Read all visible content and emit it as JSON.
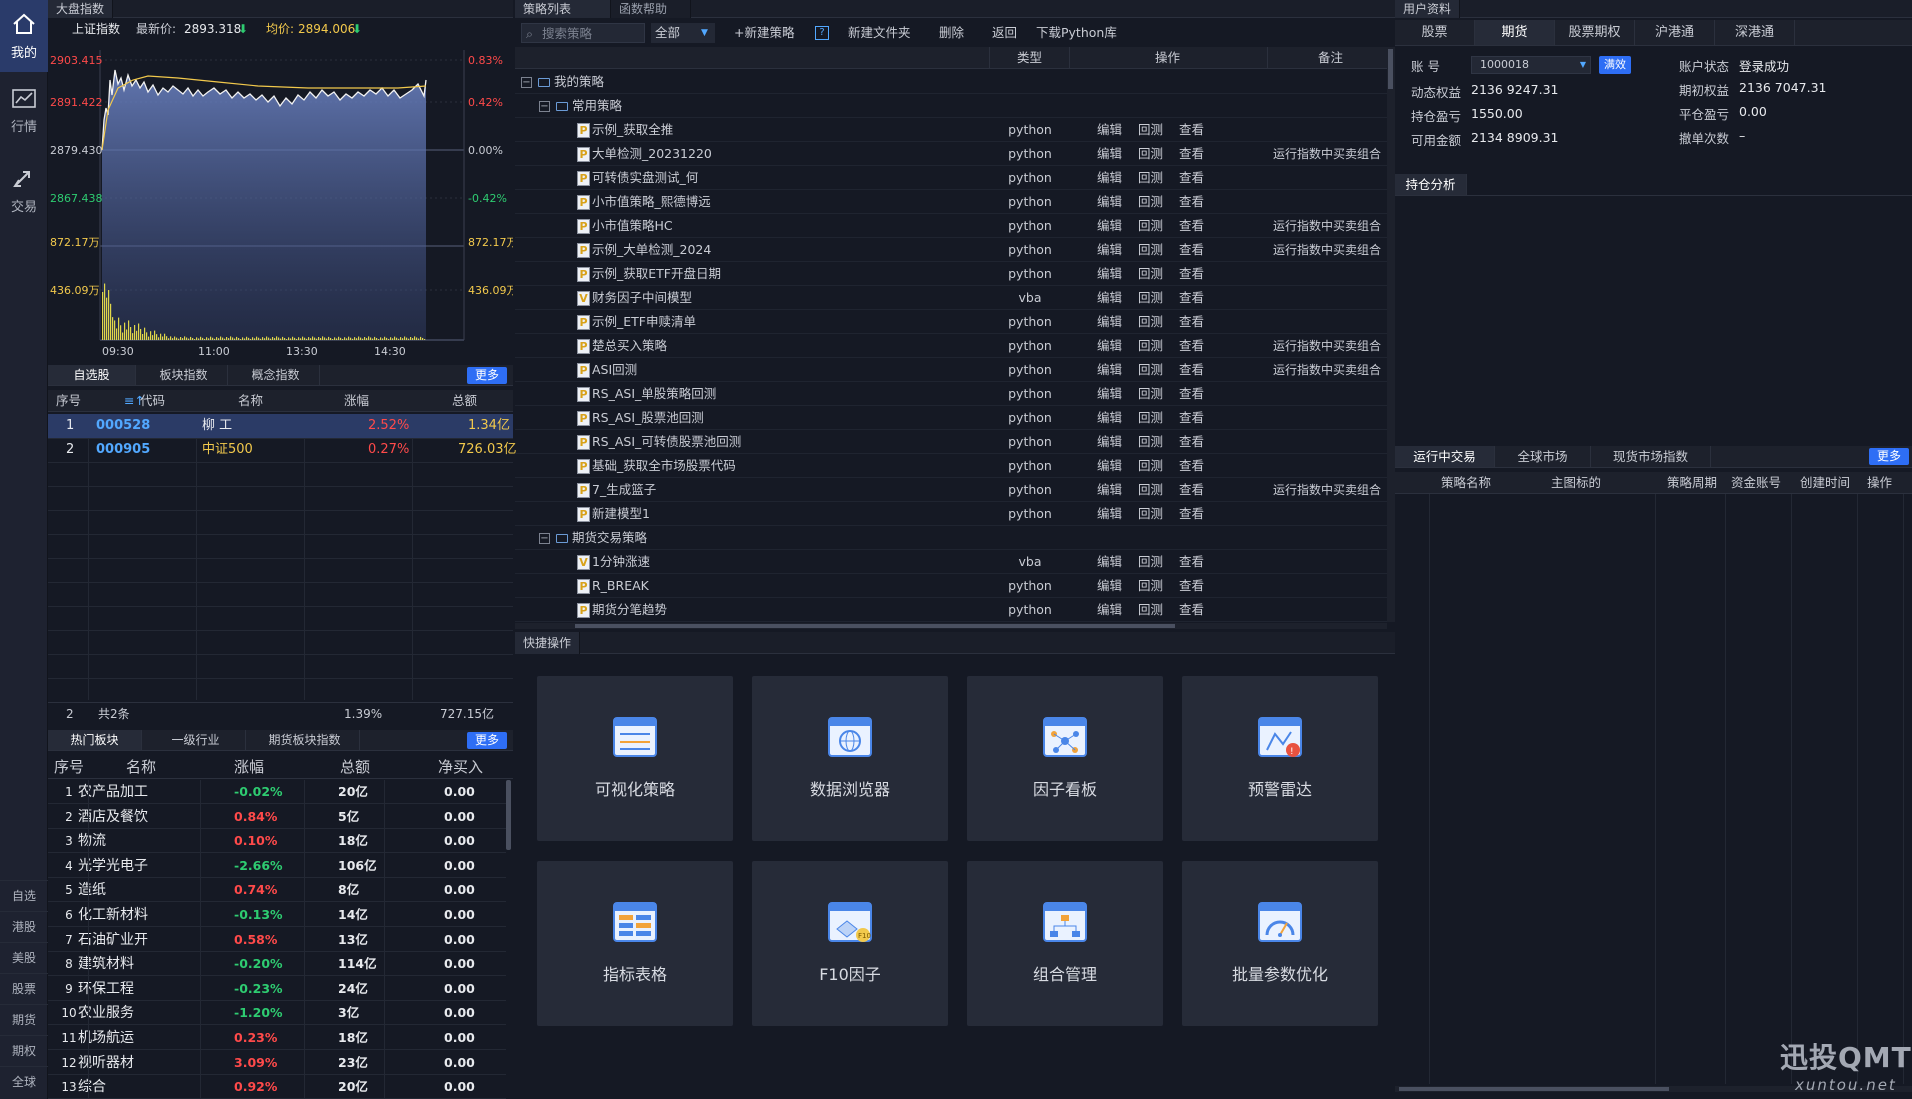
{
  "rail": {
    "main": [
      {
        "label": "我的",
        "icon": "home-icon"
      },
      {
        "label": "行情",
        "icon": "chart-icon"
      },
      {
        "label": "交易",
        "icon": "trade-icon"
      }
    ],
    "small": [
      "自选",
      "港股",
      "美股",
      "股票",
      "期货",
      "期权",
      "全球"
    ]
  },
  "market": {
    "header": "大盘指数",
    "index_name": "上证指数",
    "latest_label": "最新价:",
    "latest_value": "2893.318",
    "avg_label": "均价:",
    "avg_value": "2894.006",
    "left_axis": [
      "2903.415",
      "2891.422",
      "2879.430",
      "2867.438",
      "872.17万",
      "436.09万"
    ],
    "right_axis": [
      "0.83%",
      "0.42%",
      "0.00%",
      "-0.42%",
      "872.17万",
      "436.09万"
    ],
    "time_ticks": [
      "09:30",
      "11:00",
      "13:30",
      "14:30"
    ]
  },
  "watch": {
    "tabs": [
      "自选股",
      "板块指数",
      "概念指数"
    ],
    "more": "更多",
    "columns": [
      "序号",
      "代码",
      "名称",
      "涨幅",
      "总额"
    ],
    "rows": [
      {
        "no": "1",
        "code": "000528",
        "name": "柳 工",
        "chg": "2.52%",
        "amt": "1.34亿"
      },
      {
        "no": "2",
        "code": "000905",
        "name": "中证500",
        "chg": "0.27%",
        "amt": "726.03亿"
      }
    ],
    "footer": {
      "no": "2",
      "count": "共2条",
      "chg": "1.39%",
      "amt": "727.15亿"
    }
  },
  "sectors": {
    "tabs": [
      "热门板块",
      "一级行业",
      "期货板块指数"
    ],
    "more": "更多",
    "columns": [
      "序号",
      "名称",
      "涨幅",
      "总额",
      "净买入"
    ],
    "rows": [
      {
        "no": "1",
        "name": "农产品加工",
        "chg": "-0.02%",
        "amt": "20亿",
        "net": "0.00"
      },
      {
        "no": "2",
        "name": "酒店及餐饮",
        "chg": "0.84%",
        "amt": "5亿",
        "net": "0.00"
      },
      {
        "no": "3",
        "name": "物流",
        "chg": "0.10%",
        "amt": "18亿",
        "net": "0.00"
      },
      {
        "no": "4",
        "name": "光学光电子",
        "chg": "-2.66%",
        "amt": "106亿",
        "net": "0.00"
      },
      {
        "no": "5",
        "name": "造纸",
        "chg": "0.74%",
        "amt": "8亿",
        "net": "0.00"
      },
      {
        "no": "6",
        "name": "化工新材料",
        "chg": "-0.13%",
        "amt": "14亿",
        "net": "0.00"
      },
      {
        "no": "7",
        "name": "石油矿业开",
        "chg": "0.58%",
        "amt": "13亿",
        "net": "0.00"
      },
      {
        "no": "8",
        "name": "建筑材料",
        "chg": "-0.20%",
        "amt": "114亿",
        "net": "0.00"
      },
      {
        "no": "9",
        "name": "环保工程",
        "chg": "-0.23%",
        "amt": "24亿",
        "net": "0.00"
      },
      {
        "no": "10",
        "name": "农业服务",
        "chg": "-1.20%",
        "amt": "3亿",
        "net": "0.00"
      },
      {
        "no": "11",
        "name": "机场航运",
        "chg": "0.23%",
        "amt": "18亿",
        "net": "0.00"
      },
      {
        "no": "12",
        "name": "视听器材",
        "chg": "3.09%",
        "amt": "23亿",
        "net": "0.00"
      },
      {
        "no": "13",
        "name": "综合",
        "chg": "0.92%",
        "amt": "20亿",
        "net": "0.00"
      }
    ]
  },
  "strategy": {
    "tabs": [
      "策略列表",
      "函数帮助"
    ],
    "search_placeholder": "搜索策略",
    "filter": "全部",
    "toolbar": [
      "+新建策略",
      "新建文件夹",
      "删除",
      "返回",
      "下载Python库"
    ],
    "help_icon": "?",
    "columns": [
      "类型",
      "操作",
      "备注"
    ],
    "root": "我的策略",
    "ops": [
      "编辑",
      "回测",
      "查看"
    ],
    "groups": [
      {
        "name": "常用策略",
        "items": [
          {
            "name": "示例_获取全推",
            "kind": "P",
            "type": "python",
            "note": ""
          },
          {
            "name": "大单检测_20231220",
            "kind": "P",
            "type": "python",
            "note": "运行指数中买卖组合"
          },
          {
            "name": "可转债实盘测试_何",
            "kind": "P",
            "type": "python",
            "note": ""
          },
          {
            "name": "小市值策略_熙德博远",
            "kind": "P",
            "type": "python",
            "note": ""
          },
          {
            "name": "小市值策略HC",
            "kind": "P",
            "type": "python",
            "note": "运行指数中买卖组合"
          },
          {
            "name": "示例_大单检测_2024",
            "kind": "P",
            "type": "python",
            "note": "运行指数中买卖组合"
          },
          {
            "name": "示例_获取ETF开盘日期",
            "kind": "P",
            "type": "python",
            "note": ""
          },
          {
            "name": "财务因子中间模型",
            "kind": "V",
            "type": "vba",
            "note": ""
          },
          {
            "name": "示例_ETF申赎清单",
            "kind": "P",
            "type": "python",
            "note": ""
          },
          {
            "name": "楚总买入策略",
            "kind": "P",
            "type": "python",
            "note": "运行指数中买卖组合"
          },
          {
            "name": "ASI回测",
            "kind": "P",
            "type": "python",
            "note": "运行指数中买卖组合"
          },
          {
            "name": "RS_ASI_单股策略回测",
            "kind": "P",
            "type": "python",
            "note": ""
          },
          {
            "name": "RS_ASI_股票池回测",
            "kind": "P",
            "type": "python",
            "note": ""
          },
          {
            "name": "RS_ASI_可转债股票池回测",
            "kind": "P",
            "type": "python",
            "note": ""
          },
          {
            "name": "基础_获取全市场股票代码",
            "kind": "P",
            "type": "python",
            "note": ""
          },
          {
            "name": "7_生成篮子",
            "kind": "P",
            "type": "python",
            "note": "运行指数中买卖组合"
          },
          {
            "name": "新建模型1",
            "kind": "P",
            "type": "python",
            "note": ""
          }
        ]
      },
      {
        "name": "期货交易策略",
        "items": [
          {
            "name": "1分钟涨速",
            "kind": "V",
            "type": "vba",
            "note": ""
          },
          {
            "name": "R_BREAK",
            "kind": "P",
            "type": "python",
            "note": ""
          },
          {
            "name": "期货分笔趋势",
            "kind": "P",
            "type": "python",
            "note": ""
          }
        ]
      }
    ]
  },
  "quick": {
    "header": "快捷操作",
    "cards": [
      {
        "label": "可视化策略",
        "icon": "visual-strategy-icon"
      },
      {
        "label": "数据浏览器",
        "icon": "data-browser-icon"
      },
      {
        "label": "因子看板",
        "icon": "factor-board-icon"
      },
      {
        "label": "预警雷达",
        "icon": "alert-radar-icon"
      },
      {
        "label": "指标表格",
        "icon": "indicator-table-icon"
      },
      {
        "label": "F10因子",
        "icon": "f10-factor-icon"
      },
      {
        "label": "组合管理",
        "icon": "portfolio-icon"
      },
      {
        "label": "批量参数优化",
        "icon": "batch-optimize-icon"
      }
    ]
  },
  "account": {
    "header": "用户资料",
    "tabs": [
      "股票",
      "期货",
      "股票期权",
      "沪港通",
      "深港通"
    ],
    "account_label": "账   号",
    "account_value": "1000018",
    "status_badge": "满效",
    "fields_left": [
      {
        "label": "动态权益",
        "value": "2136 9247.31"
      },
      {
        "label": "持仓盈亏",
        "value": "1550.00"
      },
      {
        "label": "可用金额",
        "value": "2134 8909.31"
      }
    ],
    "fields_right": [
      {
        "label": "账户状态",
        "value": "登录成功"
      },
      {
        "label": "期初权益",
        "value": "2136 7047.31"
      },
      {
        "label": "平仓盈亏",
        "value": "0.00"
      },
      {
        "label": "撤单次数",
        "value": "–"
      }
    ],
    "holdings_tab": "持仓分析"
  },
  "running": {
    "tabs": [
      "运行中交易",
      "全球市场",
      "现货市场指数"
    ],
    "more": "更多",
    "columns": [
      "策略名称",
      "主图标的",
      "策略周期",
      "资金账号",
      "创建时间",
      "操作"
    ]
  },
  "brand": {
    "name": "迅投QMT",
    "domain": "xuntou.net"
  },
  "colors": {
    "up": "#ff4a4a",
    "down": "#2ecc71",
    "accent": "#2e6ef5",
    "price_line": "#f2f2f2",
    "avg_line": "#f2c94c"
  }
}
